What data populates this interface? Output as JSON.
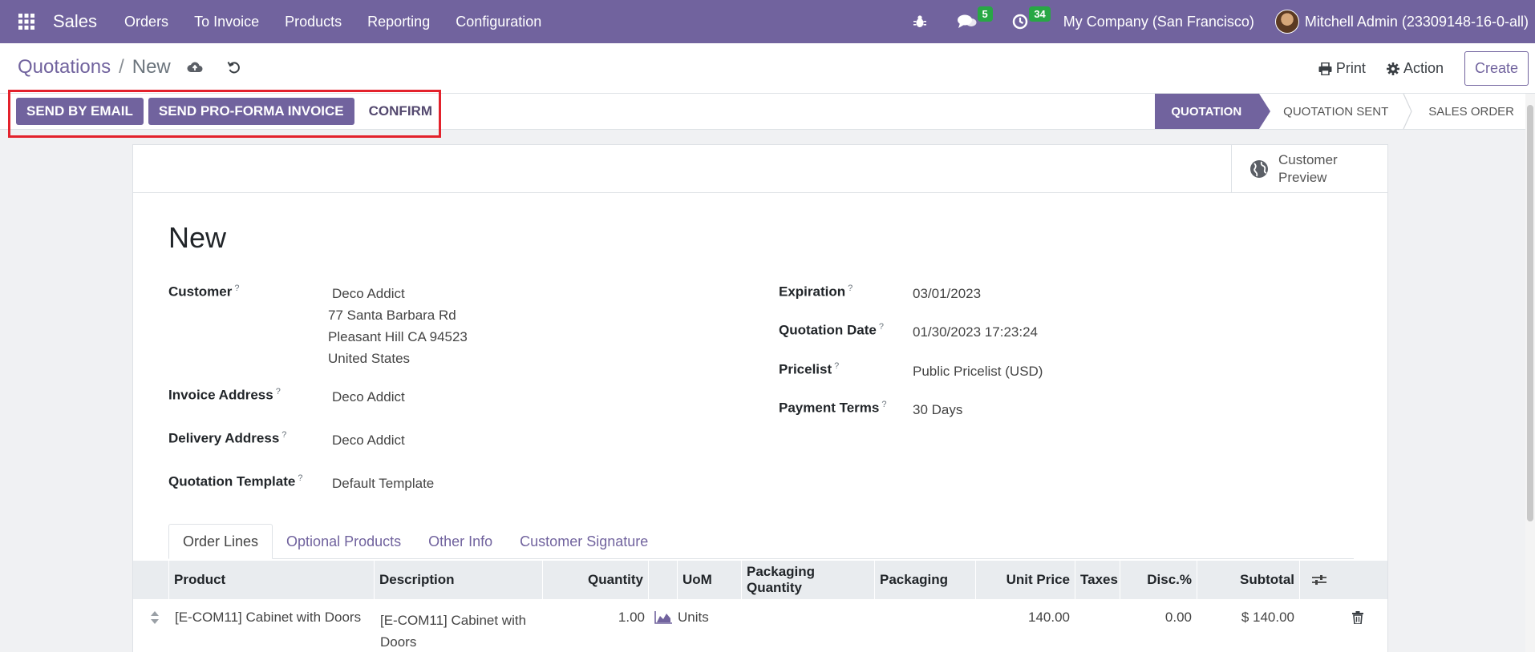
{
  "navbar": {
    "app_name": "Sales",
    "menu": [
      "Orders",
      "To Invoice",
      "Products",
      "Reporting",
      "Configuration"
    ],
    "messages_badge": "5",
    "activities_badge": "34",
    "company": "My Company (San Francisco)",
    "user": "Mitchell Admin (23309148-16-0-all)"
  },
  "breadcrumb": {
    "parent": "Quotations",
    "separator": "/",
    "current": "New"
  },
  "control": {
    "print_label": "Print",
    "action_label": "Action",
    "create_label": "Create"
  },
  "actions": {
    "send_email": "SEND BY EMAIL",
    "send_proforma": "SEND PRO-FORMA INVOICE",
    "confirm": "CONFIRM"
  },
  "stages": [
    {
      "label": "QUOTATION",
      "active": true
    },
    {
      "label": "QUOTATION SENT",
      "active": false
    },
    {
      "label": "SALES ORDER",
      "active": false
    }
  ],
  "preview": {
    "line1": "Customer",
    "line2": "Preview"
  },
  "record": {
    "title": "New",
    "customer_label": "Customer",
    "customer": "Deco Addict",
    "address_line1": "77 Santa Barbara Rd",
    "address_line2": "Pleasant Hill CA 94523",
    "address_line3": "United States",
    "invoice_address_label": "Invoice Address",
    "invoice_address": "Deco Addict",
    "delivery_address_label": "Delivery Address",
    "delivery_address": "Deco Addict",
    "template_label": "Quotation Template",
    "template": "Default Template",
    "expiration_label": "Expiration",
    "expiration": "03/01/2023",
    "quotation_date_label": "Quotation Date",
    "quotation_date": "01/30/2023 17:23:24",
    "pricelist_label": "Pricelist",
    "pricelist": "Public Pricelist (USD)",
    "payment_terms_label": "Payment Terms",
    "payment_terms": "30 Days"
  },
  "tabs": [
    "Order Lines",
    "Optional Products",
    "Other Info",
    "Customer Signature"
  ],
  "table": {
    "headers": {
      "product": "Product",
      "description": "Description",
      "quantity": "Quantity",
      "uom": "UoM",
      "packaging_qty": "Packaging Quantity",
      "packaging": "Packaging",
      "unit_price": "Unit Price",
      "taxes": "Taxes",
      "disc": "Disc.%",
      "subtotal": "Subtotal"
    },
    "rows": [
      {
        "product": "[E-COM11] Cabinet with Doors",
        "description_line1": "[E-COM11] Cabinet with",
        "description_line2": "Doors",
        "quantity": "1.00",
        "uom": "Units",
        "unit_price": "140.00",
        "disc": "0.00",
        "subtotal": "$ 140.00"
      }
    ]
  },
  "colors": {
    "brand": "#71639e",
    "badge": "#28a745",
    "highlight": "#e3222c"
  }
}
